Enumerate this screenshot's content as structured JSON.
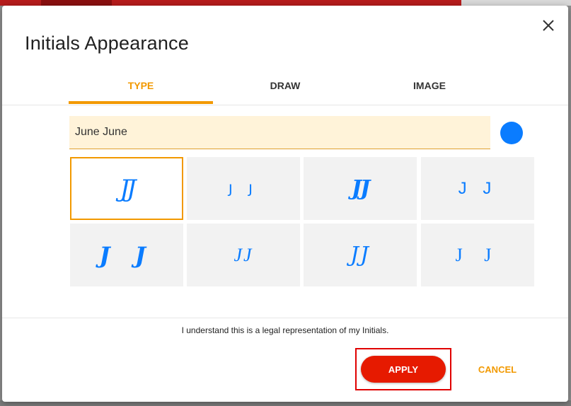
{
  "dialog": {
    "title": "Initials Appearance",
    "close_icon": "close-icon"
  },
  "tabs": [
    {
      "label": "TYPE",
      "active": true
    },
    {
      "label": "DRAW",
      "active": false
    },
    {
      "label": "IMAGE",
      "active": false
    }
  ],
  "type_panel": {
    "name_value": "June June",
    "color": "#0a7cff",
    "styles": [
      {
        "text": "JJ",
        "selected": true
      },
      {
        "text": "J J",
        "selected": false
      },
      {
        "text": "JJ",
        "selected": false
      },
      {
        "text": "J J",
        "selected": false
      },
      {
        "text": "J J",
        "selected": false
      },
      {
        "text": "JJ",
        "selected": false
      },
      {
        "text": "JJ",
        "selected": false
      },
      {
        "text": "J J",
        "selected": false
      }
    ]
  },
  "footer": {
    "legal_text": "I understand this is a legal representation of my Initials.",
    "apply_label": "APPLY",
    "cancel_label": "CANCEL"
  },
  "colors": {
    "accent": "#f29900",
    "apply": "#e61a00",
    "initials": "#0a7cff"
  }
}
